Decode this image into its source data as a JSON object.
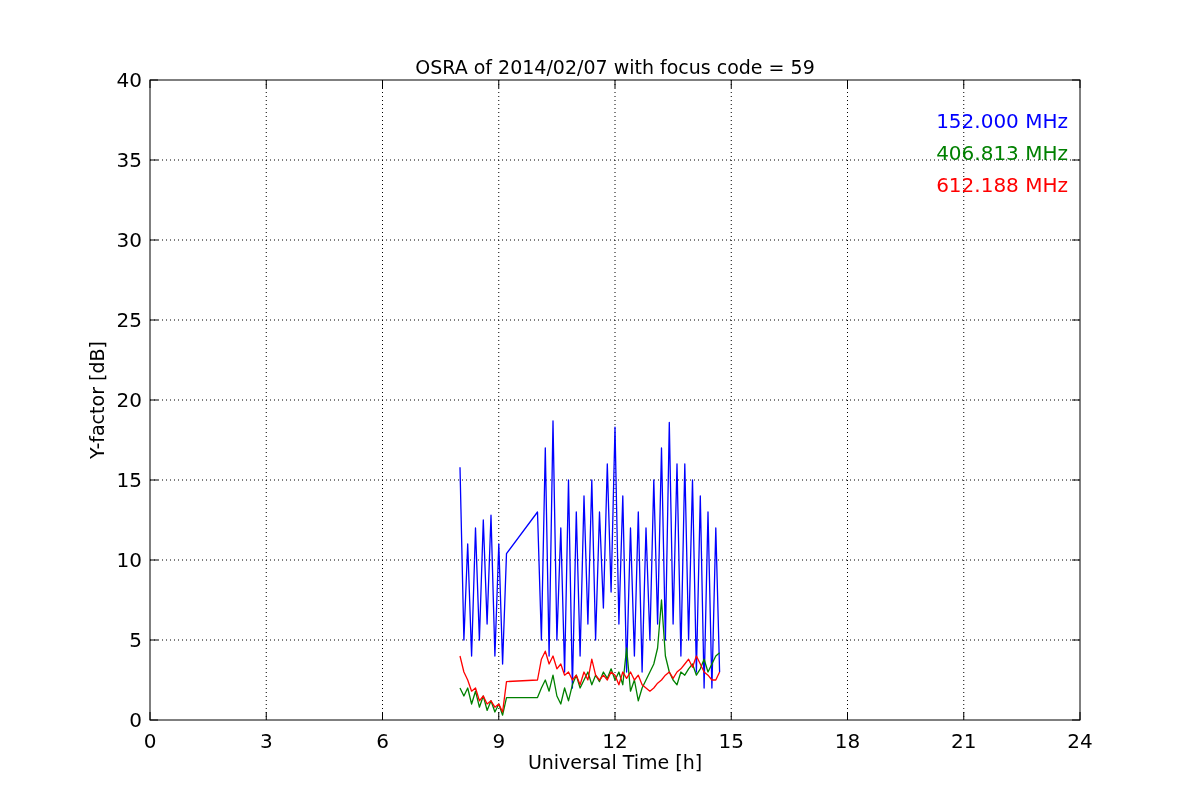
{
  "figure": {
    "chart_data": {
      "type": "line",
      "title": "OSRA of 2014/02/07 with focus code = 59",
      "xlabel": "Universal Time [h]",
      "ylabel": "Y-factor [dB]",
      "x": [
        8,
        8.1,
        8.2,
        8.3,
        8.4,
        8.5,
        8.6,
        8.7,
        8.8,
        8.9,
        9,
        9.1,
        9.2,
        10,
        10.1,
        10.2,
        10.3,
        10.4,
        10.5,
        10.6,
        10.7,
        10.8,
        10.9,
        11,
        11.1,
        11.2,
        11.3,
        11.4,
        11.5,
        11.6,
        11.7,
        11.8,
        11.9,
        12,
        12.1,
        12.2,
        12.3,
        12.4,
        12.5,
        12.6,
        12.7,
        12.8,
        12.9,
        13,
        13.1,
        13.2,
        13.3,
        13.4,
        13.5,
        13.6,
        13.7,
        13.8,
        13.9,
        14,
        14.1,
        14.2,
        14.3,
        14.4,
        14.5,
        14.6,
        14.7
      ],
      "series": [
        {
          "name": "152.000 MHz",
          "color": "#0000ff",
          "values": [
            15.8,
            5,
            11,
            4,
            12,
            5,
            12.5,
            6,
            12.8,
            4,
            11,
            3.5,
            10.4,
            13,
            5,
            17,
            4,
            18.7,
            5,
            12,
            3,
            15,
            2,
            13,
            4,
            14,
            6,
            15,
            5,
            13,
            7,
            16,
            8,
            18.3,
            6,
            14,
            3,
            12,
            4,
            13,
            3,
            12,
            5,
            15,
            6,
            17,
            5,
            18.6,
            6,
            16,
            4,
            16,
            5,
            15,
            3,
            14,
            2,
            13,
            2,
            12,
            3
          ]
        },
        {
          "name": "406.813 MHz",
          "color": "#008000",
          "values": [
            2,
            1.5,
            2,
            1,
            1.8,
            0.8,
            1.5,
            0.6,
            1.2,
            0.5,
            1,
            0.3,
            1.4,
            1.4,
            2,
            2.5,
            1.8,
            2.8,
            1.5,
            1,
            2,
            1.2,
            2.2,
            2.8,
            2,
            2.5,
            3,
            2.2,
            2.8,
            2.4,
            3,
            2.6,
            3.2,
            2.5,
            3,
            2.2,
            4.5,
            1.8,
            2.5,
            1.2,
            2,
            2.5,
            3,
            3.5,
            4.5,
            7.5,
            4,
            3,
            2.5,
            2.2,
            3,
            2.8,
            3.2,
            3.5,
            2.8,
            3.2,
            3.8,
            3,
            3.5,
            4,
            4.2
          ]
        },
        {
          "name": "612.188 MHz",
          "color": "#ff0000",
          "values": [
            4,
            3,
            2.5,
            1.8,
            2,
            1.2,
            1.5,
            1,
            1.2,
            0.8,
            1,
            0.5,
            2.4,
            2.5,
            3.8,
            4.3,
            3.5,
            4,
            3.2,
            3.5,
            2.8,
            3,
            2.5,
            2.8,
            2.2,
            3,
            2.5,
            3.8,
            2.8,
            2.5,
            2.8,
            2.5,
            3,
            2.8,
            2.2,
            3,
            2.6,
            3,
            2.5,
            2.8,
            2.2,
            2,
            1.8,
            2,
            2.3,
            2.5,
            2.8,
            3,
            2.6,
            3,
            3.2,
            3.5,
            3.8,
            3.3,
            4,
            3.5,
            3,
            2.8,
            2.5,
            2.5,
            3
          ]
        }
      ],
      "xlim": [
        0,
        24
      ],
      "ylim": [
        0,
        40
      ],
      "xticks": [
        0,
        3,
        6,
        9,
        12,
        15,
        18,
        21,
        24
      ],
      "yticks": [
        0,
        5,
        10,
        15,
        20,
        25,
        30,
        35,
        40
      ],
      "grid": true
    }
  }
}
